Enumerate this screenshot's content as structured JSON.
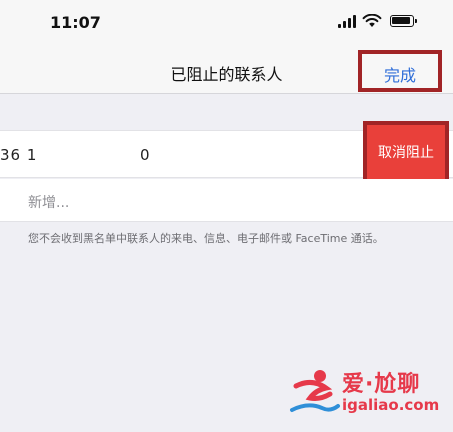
{
  "status_bar": {
    "time": "11:07"
  },
  "nav": {
    "title": "已阻止的联系人",
    "done_label": "完成"
  },
  "contact": {
    "number_part_1": "36 1",
    "number_part_2": "0",
    "unblock_label": "取消阻止"
  },
  "add_new": {
    "label": "新增..."
  },
  "footer": {
    "note": "您不会收到黑名单中联系人的来电、信息、电子邮件或 FaceTime 通话。"
  },
  "watermark": {
    "brand": "爱·尬聊",
    "domain": "igaliao.com"
  },
  "colors": {
    "accent_blue": "#2f6ed8",
    "unblock_red": "#e9403a",
    "highlight_border": "#a12426",
    "watermark_red": "#e6394a"
  }
}
